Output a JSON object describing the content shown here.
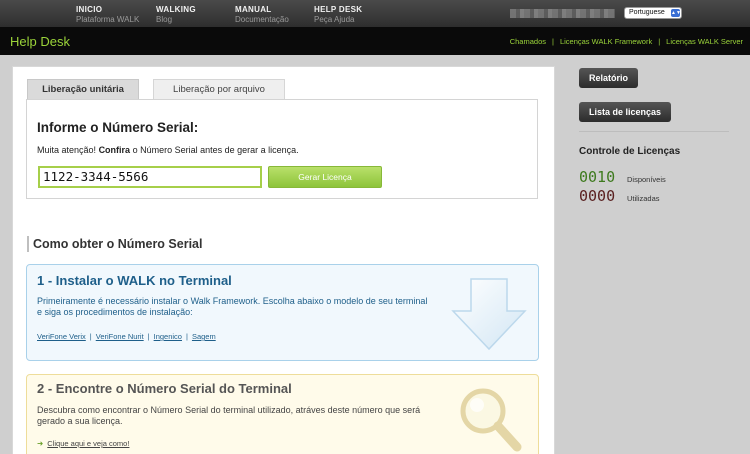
{
  "nav": {
    "items": [
      {
        "title": "INICIO",
        "sub": "Plataforma WALK"
      },
      {
        "title": "WALKING",
        "sub": "Blog"
      },
      {
        "title": "MANUAL",
        "sub": "Documentação"
      },
      {
        "title": "HELP DESK",
        "sub": "Peça Ajuda"
      }
    ],
    "language": "Portuguese"
  },
  "header": {
    "title": "Help Desk",
    "links": [
      "Chamados",
      "Licenças WALK Framework",
      "Licenças WALK Server"
    ]
  },
  "tabs": [
    "Liberação unitária",
    "Liberação por arquivo"
  ],
  "serial": {
    "heading": "Informe o Número Serial:",
    "note_prefix": "Muita atenção!",
    "note_bold": "Confira",
    "note_suffix": "o Número Serial antes de gerar a licença.",
    "value": "1122-3344-5566",
    "button": "Gerar Licença"
  },
  "section_title": "Como obter o Número Serial",
  "step1": {
    "title": "1 - Instalar o WALK no Terminal",
    "text": "Primeiramente é necessário instalar o Walk Framework. Escolha abaixo o modelo de seu terminal e siga os procedimentos de instalação:",
    "links": [
      "VeriFone Verix",
      "VeriFone Nurit",
      "Ingenico",
      "Sagem"
    ]
  },
  "step2": {
    "title": "2 - Encontre o Número Serial do Terminal",
    "text": "Descubra como encontrar o Número Serial do terminal utilizado, atráves deste número que será gerado a sua licença.",
    "link": "Clique aqui e veja como!"
  },
  "sidebar": {
    "btn_report": "Relatório",
    "btn_licenses": "Lista de licenças",
    "heading": "Controle de Licenças",
    "available_count": "0010",
    "available_label": "Disponíveis",
    "used_count": "0000",
    "used_label": "Utilizadas"
  },
  "colors": {
    "accent_green": "#9bd43a",
    "step1_blue": "#1e5f8a"
  }
}
